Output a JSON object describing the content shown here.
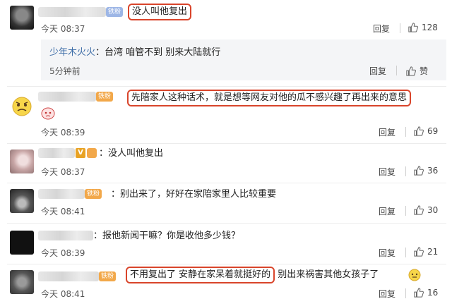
{
  "comments": [
    {
      "text": "没人叫他复出",
      "badge": "铁粉",
      "time": "今天 08:37",
      "reply": "回复",
      "likes": "128"
    },
    {
      "text": "先陪家人这种话术，就是想等网友对他的瓜不感兴趣了再出来的意思",
      "badge": "铁粉",
      "time": "今天 08:39",
      "reply": "回复",
      "likes": "69"
    },
    {
      "text": "没人叫他复出",
      "badge": "V",
      "time": "今天 08:37",
      "reply": "回复",
      "likes": "36"
    },
    {
      "text": "别出来了，好好在家陪家里人比较重要",
      "badge": "铁粉",
      "time": "今天 08:41",
      "reply": "回复",
      "likes": "30"
    },
    {
      "text": "报他新闻干嘛？你是收他多少钱？",
      "time": "今天 08:39",
      "reply": "回复",
      "likes": "21"
    },
    {
      "text_highlight": "不用复出了 安静在家呆着就挺好的",
      "text_rest": "别出来祸害其他女孩子了",
      "badge": "铁粉",
      "time": "今天 08:41",
      "reply": "回复",
      "likes": "16"
    }
  ],
  "sub_reply": {
    "name": "少年木火火",
    "text": "台湾  咱管不到 别来大陆就行",
    "time": "5分钟前",
    "reply": "回复",
    "likes": "赞"
  },
  "icons": {
    "like": "thumbs-up-icon",
    "emoji": "pout-emoji-icon"
  },
  "colors": {
    "highlight": "#d9452b",
    "name_link": "#3f6ea8",
    "badge": "#f2a84a"
  }
}
